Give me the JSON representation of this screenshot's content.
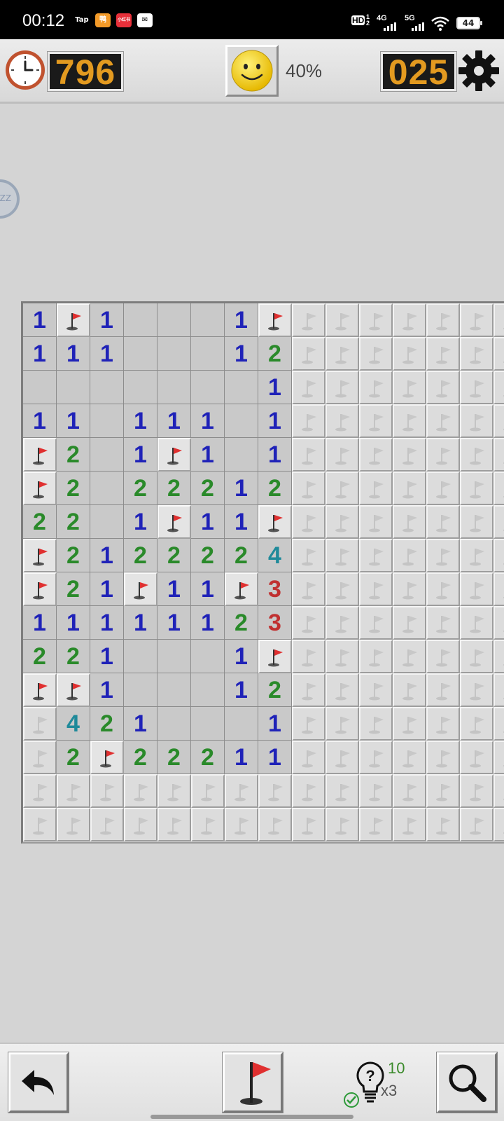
{
  "status_bar": {
    "time": "00:12",
    "apps": [
      "Tap",
      "鸭",
      "小红书",
      "✉"
    ],
    "indicators": {
      "hd": "HD",
      "sim": "1 2",
      "net1": "4G",
      "net2": "5G",
      "battery": "44"
    }
  },
  "header": {
    "timer_value": "796",
    "progress_percent": "40%",
    "mine_counter": "025",
    "icons": [
      "clock-icon",
      "smiley-icon",
      "gear-icon"
    ]
  },
  "zoom_label": "ZZ",
  "board": {
    "columns": 15,
    "legend": {
      ".": "revealed-empty",
      "F": "flagged",
      "#": "unrevealed",
      "1-8": "revealed-number"
    },
    "rows": [
      "1F1...1F#######",
      "111...12#######",
      ".......1#######",
      "11.111.1#######",
      "F2.1F1.1#######",
      "F2.22212#######",
      "22.1F11F#######",
      "F2122224#######",
      "F21F11F3#######",
      "11111123#######",
      "221...1F#######",
      "FF1...12#######",
      "#421...1#######",
      "#2F22211#######",
      "###############",
      "###############"
    ],
    "number_colors": {
      "1": "#1f22b8",
      "2": "#2a8a2a",
      "3": "#c03030",
      "4": "#1f8a9a"
    }
  },
  "toolbar": {
    "undo_icon": "undo-arrow-icon",
    "flag_mode_icon": "flag-icon",
    "hints_remaining": "10",
    "hint_multiplier": "x3",
    "magnifier_icon": "magnifier-icon"
  }
}
